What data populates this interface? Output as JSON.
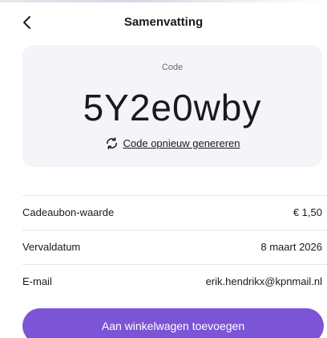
{
  "header": {
    "title": "Samenvatting",
    "back_icon": "chevron-left-icon"
  },
  "code_card": {
    "caption": "Code",
    "code": "5Y2e0wby",
    "regenerate_icon": "refresh-icon",
    "regenerate_label": "Code opnieuw genereren"
  },
  "details": {
    "rows": [
      {
        "label": "Cadeaubon-waarde",
        "value": "€ 1,50"
      },
      {
        "label": "Vervaldatum",
        "value": "8 maart 2026"
      },
      {
        "label": "E-mail",
        "value": "erik.hendrikx@kpnmail.nl"
      }
    ]
  },
  "actions": {
    "add_to_cart_label": "Aan winkelwagen toevoegen"
  },
  "colors": {
    "accent": "#7b55d6",
    "card_background": "#f5f4f8"
  }
}
